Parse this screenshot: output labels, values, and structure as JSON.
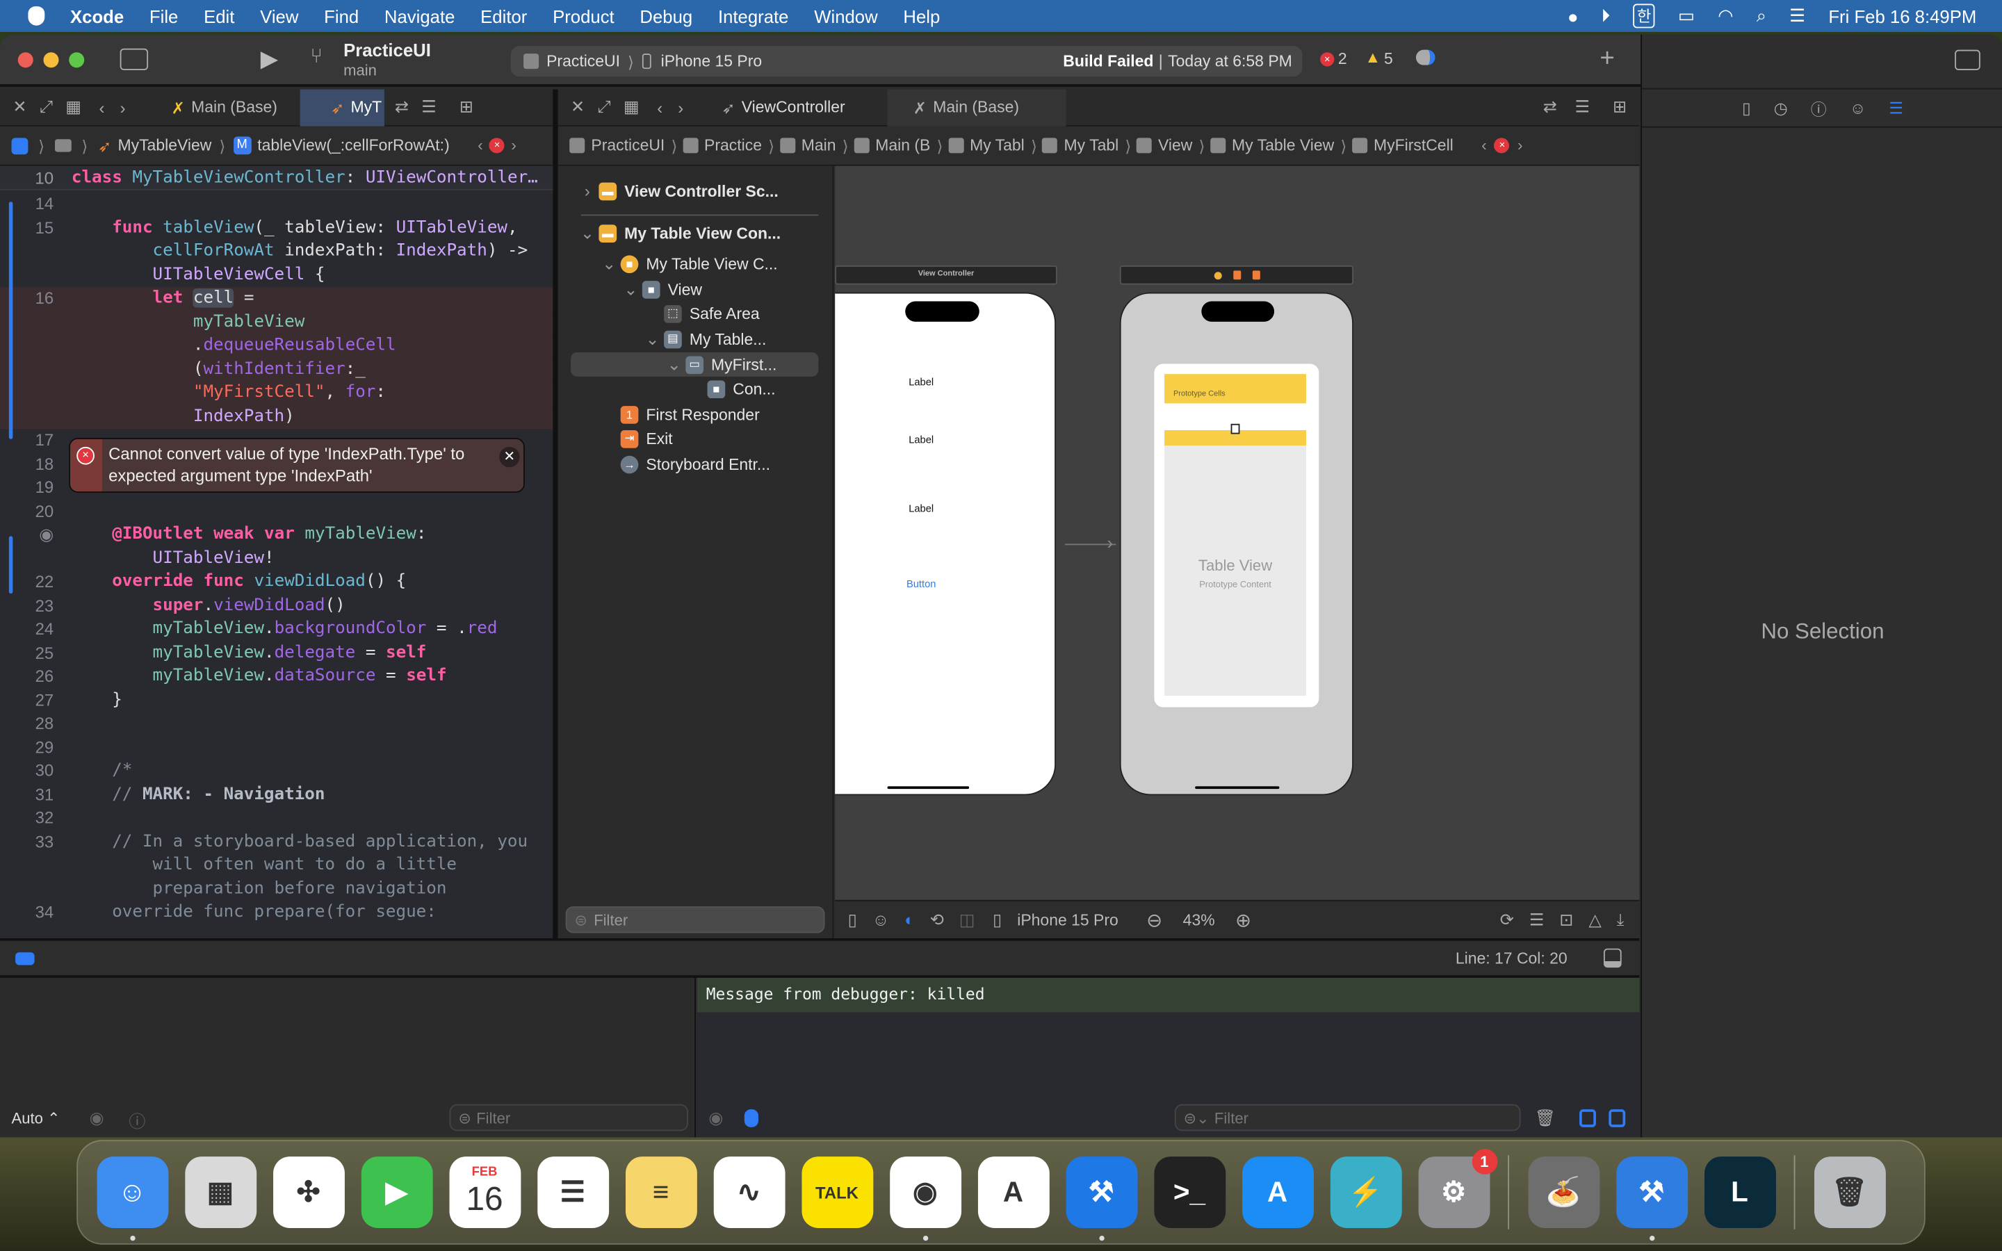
{
  "menubar": {
    "app": "Xcode",
    "items": [
      "File",
      "Edit",
      "View",
      "Find",
      "Navigate",
      "Editor",
      "Product",
      "Debug",
      "Integrate",
      "Window",
      "Help"
    ],
    "status_icons": [
      "coconut-battery-icon",
      "play-circle-icon",
      "korean-input-icon",
      "battery-charging-icon",
      "wifi-icon",
      "spotlight-search-icon",
      "control-center-icon"
    ],
    "input_label": "한",
    "clock": "Fri Feb 16  8:49PM"
  },
  "toolbar": {
    "project": "PracticeUI",
    "branch": "main",
    "scheme": "PracticeUI",
    "destination": "iPhone 15 Pro",
    "build_status": "Build Failed",
    "build_time": "Today at 6:58 PM",
    "errors": "2",
    "warnings": "5"
  },
  "left_editor": {
    "tabs": [
      {
        "label": "Main (Base)",
        "active": false
      },
      {
        "label": "MyT",
        "active": true
      }
    ],
    "jumpbar": [
      "MyTableView",
      "tableView(_:cellForRowAt:)"
    ]
  },
  "right_editor": {
    "tabs": [
      {
        "label": "ViewController",
        "active": false
      },
      {
        "label": "Main (Base)",
        "active": true
      }
    ],
    "jumpbar": [
      "PracticeUI",
      "Practice",
      "Main",
      "Main (B",
      "My Tabl",
      "My Tabl",
      "View",
      "My Table View",
      "MyFirstCell"
    ]
  },
  "code": {
    "sticky": {
      "n": "10",
      "t": [
        [
          "class",
          "kw"
        ],
        [
          " ",
          "p"
        ],
        [
          "MyTableViewController",
          "fn"
        ],
        [
          ": ",
          "p"
        ],
        [
          "UIViewController…",
          "ty"
        ]
      ]
    },
    "rows": [
      {
        "n": "14",
        "t": []
      },
      {
        "n": "15",
        "t": [
          [
            "    ",
            "p"
          ],
          [
            "func",
            "kw"
          ],
          [
            " ",
            "p"
          ],
          [
            "tableView",
            "fn"
          ],
          [
            "(_ tableView: ",
            "p"
          ],
          [
            "UITableView",
            "ty"
          ],
          [
            ",",
            "p"
          ]
        ]
      },
      {
        "n": "",
        "t": [
          [
            "        ",
            "p"
          ],
          [
            "cellForRowAt",
            "fn"
          ],
          [
            " indexPath: ",
            "p"
          ],
          [
            "IndexPath",
            "ty"
          ],
          [
            ") ->",
            "p"
          ]
        ]
      },
      {
        "n": "",
        "t": [
          [
            "        ",
            "p"
          ],
          [
            "UITableViewCell",
            "ty"
          ],
          [
            " {",
            "p"
          ]
        ]
      },
      {
        "n": "16",
        "err": true,
        "t": [
          [
            "        ",
            "p"
          ],
          [
            "let",
            "kw"
          ],
          [
            " ",
            "p"
          ],
          [
            "cell",
            "hl"
          ],
          [
            " =",
            "p"
          ]
        ]
      },
      {
        "n": "",
        "err": true,
        "t": [
          [
            "            ",
            "p"
          ],
          [
            "myTableView",
            "id"
          ]
        ]
      },
      {
        "n": "",
        "err": true,
        "t": [
          [
            "            ",
            "p"
          ],
          [
            ".",
            "p"
          ],
          [
            "dequeueReusableCell",
            "me"
          ]
        ]
      },
      {
        "n": "",
        "err": true,
        "t": [
          [
            "            ",
            "p"
          ],
          [
            "(",
            "p"
          ],
          [
            "withIdentifier",
            "me"
          ],
          [
            ":_",
            "p"
          ]
        ]
      },
      {
        "n": "",
        "err": true,
        "t": [
          [
            "            ",
            "p"
          ],
          [
            "\"MyFirstCell\"",
            "st"
          ],
          [
            ", ",
            "p"
          ],
          [
            "for",
            "me"
          ],
          [
            ":",
            "p"
          ]
        ]
      },
      {
        "n": "",
        "err": true,
        "t": [
          [
            "            ",
            "p"
          ],
          [
            "IndexPath",
            "ty"
          ],
          [
            ")",
            "p"
          ]
        ]
      },
      {
        "n": "17",
        "t": []
      },
      {
        "n": "18",
        "t": []
      },
      {
        "n": "19",
        "t": []
      },
      {
        "n": "20",
        "t": []
      },
      {
        "n": "◉",
        "t": [
          [
            "    ",
            "p"
          ],
          [
            "@IBOutlet",
            "kw"
          ],
          [
            " ",
            "p"
          ],
          [
            "weak",
            "kw"
          ],
          [
            " ",
            "p"
          ],
          [
            "var",
            "kw"
          ],
          [
            " ",
            "p"
          ],
          [
            "myTableView",
            "id"
          ],
          [
            ":",
            "p"
          ]
        ]
      },
      {
        "n": "",
        "t": [
          [
            "        ",
            "p"
          ],
          [
            "UITableView",
            "ty"
          ],
          [
            "!",
            "p"
          ]
        ]
      },
      {
        "n": "22",
        "t": [
          [
            "    ",
            "p"
          ],
          [
            "override",
            "kw"
          ],
          [
            " ",
            "p"
          ],
          [
            "func",
            "kw"
          ],
          [
            " ",
            "p"
          ],
          [
            "viewDidLoad",
            "fn"
          ],
          [
            "() {",
            "p"
          ]
        ]
      },
      {
        "n": "23",
        "t": [
          [
            "        ",
            "p"
          ],
          [
            "super",
            "kw"
          ],
          [
            ".",
            "p"
          ],
          [
            "viewDidLoad",
            "me"
          ],
          [
            "()",
            "p"
          ]
        ]
      },
      {
        "n": "24",
        "t": [
          [
            "        ",
            "p"
          ],
          [
            "myTableView",
            "id"
          ],
          [
            ".",
            "p"
          ],
          [
            "backgroundColor",
            "me"
          ],
          [
            " = .",
            "p"
          ],
          [
            "red",
            "me"
          ]
        ]
      },
      {
        "n": "25",
        "t": [
          [
            "        ",
            "p"
          ],
          [
            "myTableView",
            "id"
          ],
          [
            ".",
            "p"
          ],
          [
            "delegate",
            "me"
          ],
          [
            " = ",
            "p"
          ],
          [
            "self",
            "kw"
          ]
        ]
      },
      {
        "n": "26",
        "t": [
          [
            "        ",
            "p"
          ],
          [
            "myTableView",
            "id"
          ],
          [
            ".",
            "p"
          ],
          [
            "dataSource",
            "me"
          ],
          [
            " = ",
            "p"
          ],
          [
            "self",
            "kw"
          ]
        ]
      },
      {
        "n": "27",
        "t": [
          [
            "    }",
            "p"
          ]
        ]
      },
      {
        "n": "28",
        "t": []
      },
      {
        "n": "29",
        "t": []
      },
      {
        "n": "30",
        "t": [
          [
            "    /*",
            "cm"
          ]
        ]
      },
      {
        "n": "31",
        "t": [
          [
            "    // ",
            "cm"
          ],
          [
            "MARK: - Navigation",
            "mk"
          ]
        ]
      },
      {
        "n": "32",
        "t": []
      },
      {
        "n": "33",
        "t": [
          [
            "    // In a storyboard-based application, you",
            "cm"
          ]
        ]
      },
      {
        "n": "",
        "t": [
          [
            "        will often want to do a little",
            "cm"
          ]
        ]
      },
      {
        "n": "",
        "t": [
          [
            "        preparation before navigation",
            "cm"
          ]
        ]
      },
      {
        "n": "34",
        "t": [
          [
            "    override func prepare(for segue:",
            "cm"
          ]
        ]
      }
    ],
    "error_message": "Cannot convert value of type 'IndexPath.Type' to expected argument type 'IndexPath'"
  },
  "outline": {
    "items": [
      {
        "label": "View Controller Sc...",
        "depth": 0,
        "disclosure": "collapsed",
        "icon": "scene-icon",
        "bold": true
      },
      {
        "label": "My Table View Con...",
        "depth": 0,
        "disclosure": "expanded",
        "icon": "scene-icon",
        "bold": true
      },
      {
        "label": "My Table View C...",
        "depth": 1,
        "disclosure": "expanded",
        "icon": "view-controller-icon"
      },
      {
        "label": "View",
        "depth": 2,
        "disclosure": "expanded",
        "icon": "view-icon"
      },
      {
        "label": "Safe Area",
        "depth": 3,
        "disclosure": "none",
        "icon": "safe-area-icon"
      },
      {
        "label": "My Table...",
        "depth": 3,
        "disclosure": "expanded",
        "icon": "table-view-icon"
      },
      {
        "label": "MyFirst...",
        "depth": 4,
        "disclosure": "expanded",
        "icon": "table-cell-icon",
        "selected": true
      },
      {
        "label": "Con...",
        "depth": 5,
        "disclosure": "none",
        "icon": "view-icon"
      },
      {
        "label": "First Responder",
        "depth": 1,
        "disclosure": "none",
        "icon": "first-responder-icon"
      },
      {
        "label": "Exit",
        "depth": 1,
        "disclosure": "none",
        "icon": "exit-icon"
      },
      {
        "label": "Storyboard Entr...",
        "depth": 1,
        "disclosure": "none",
        "icon": "storyboard-entry-icon"
      }
    ],
    "filter_placeholder": "Filter"
  },
  "canvas": {
    "vc_title": "View Controller",
    "labels": [
      "Label",
      "Label",
      "Label"
    ],
    "button": "Button",
    "prototype_cells": "Prototype Cells",
    "table_view": "Table View",
    "prototype_content": "Prototype Content",
    "device": "iPhone 15 Pro",
    "zoom": "43%"
  },
  "inspector": {
    "empty": "No Selection"
  },
  "status": {
    "position": "Line: 17  Col: 20"
  },
  "debug": {
    "scope": "Auto ⌃",
    "filter_placeholder": "Filter",
    "console_message": "Message from debugger: killed",
    "console_filter_placeholder": "Filter"
  },
  "dock": {
    "items": [
      {
        "name": "finder",
        "color": "#3d8ef0",
        "glyph": "☺",
        "running": true
      },
      {
        "name": "launchpad",
        "color": "#d9d9d9",
        "glyph": "▦"
      },
      {
        "name": "safari",
        "color": "#ffffff",
        "glyph": "✣"
      },
      {
        "name": "facetime",
        "color": "#3ec14f",
        "glyph": "▶"
      },
      {
        "name": "calendar",
        "color": "#ffffff",
        "glyph": "16",
        "caption": "FEB"
      },
      {
        "name": "reminders",
        "color": "#ffffff",
        "glyph": "☰"
      },
      {
        "name": "notes",
        "color": "#f6d56a",
        "glyph": "≡"
      },
      {
        "name": "freeform",
        "color": "#ffffff",
        "glyph": "∿"
      },
      {
        "name": "kakaotalk",
        "color": "#fae100",
        "glyph": "TALK"
      },
      {
        "name": "chrome",
        "color": "#ffffff",
        "glyph": "◉",
        "running": true
      },
      {
        "name": "instruments",
        "color": "#ffffff",
        "glyph": "A"
      },
      {
        "name": "xcode",
        "color": "#1e78e6",
        "glyph": "⚒",
        "running": true
      },
      {
        "name": "terminal",
        "color": "#222222",
        "glyph": ">_"
      },
      {
        "name": "app-store",
        "color": "#1b8df5",
        "glyph": "A"
      },
      {
        "name": "reeder",
        "color": "#3ab0c8",
        "glyph": "⚡"
      },
      {
        "name": "system-settings",
        "color": "#8e8e93",
        "glyph": "⚙",
        "badge": "1"
      },
      {
        "sep": true
      },
      {
        "name": "cooking-app",
        "color": "#6e6e6e",
        "glyph": "🍝"
      },
      {
        "name": "xcode-beta",
        "color": "#2f7de0",
        "glyph": "⚒",
        "running": true
      },
      {
        "name": "league-of-legends",
        "color": "#0b2a3a",
        "glyph": "L"
      },
      {
        "sep": true
      },
      {
        "name": "trash",
        "color": "#b9bcbf",
        "glyph": "🗑"
      }
    ]
  },
  "colors": {
    "menubar": "#2a67ab",
    "accent": "#2f7cf6",
    "error": "#e0383e",
    "warning": "#f5c431",
    "prototype_yellow": "#f7ce46"
  }
}
